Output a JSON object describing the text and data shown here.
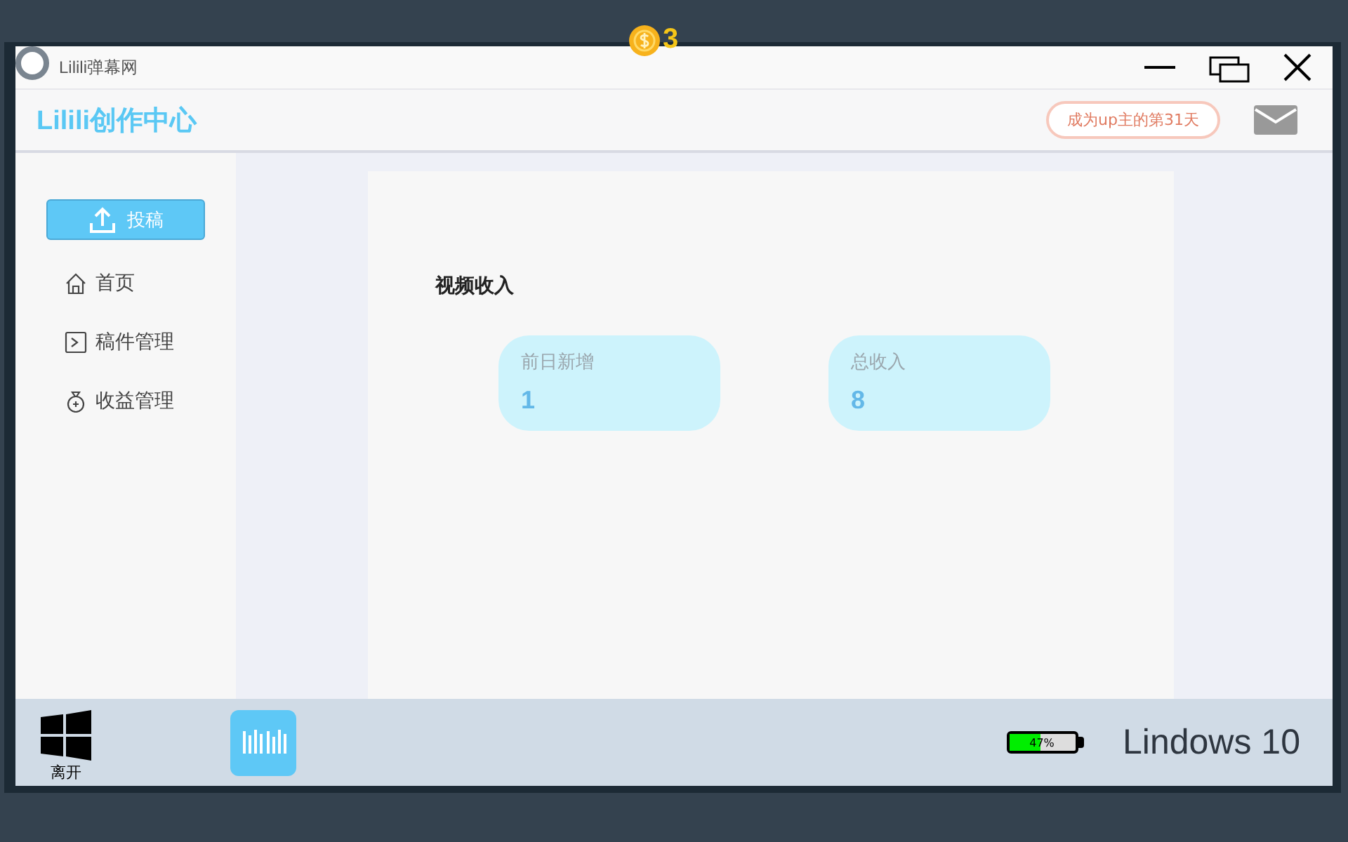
{
  "coins": "3",
  "window": {
    "title": "Lilili弹幕网"
  },
  "header": {
    "brand": "Lilili创作中心",
    "badge": "成为up主的第31天"
  },
  "sidebar": {
    "upload_button": "投稿",
    "items": [
      {
        "kind": "home",
        "label": "首页"
      },
      {
        "kind": "manuscripts",
        "label": "稿件管理"
      },
      {
        "kind": "earnings",
        "label": "收益管理"
      }
    ]
  },
  "main": {
    "section_title": "视频收入",
    "stats": [
      {
        "label": "前日新增",
        "value": "1"
      },
      {
        "label": "总收入",
        "value": "8"
      }
    ]
  },
  "taskbar": {
    "start_label": "离开",
    "battery": {
      "level": 0.47,
      "reading": "47%"
    },
    "os_name": "Lindows 10"
  }
}
